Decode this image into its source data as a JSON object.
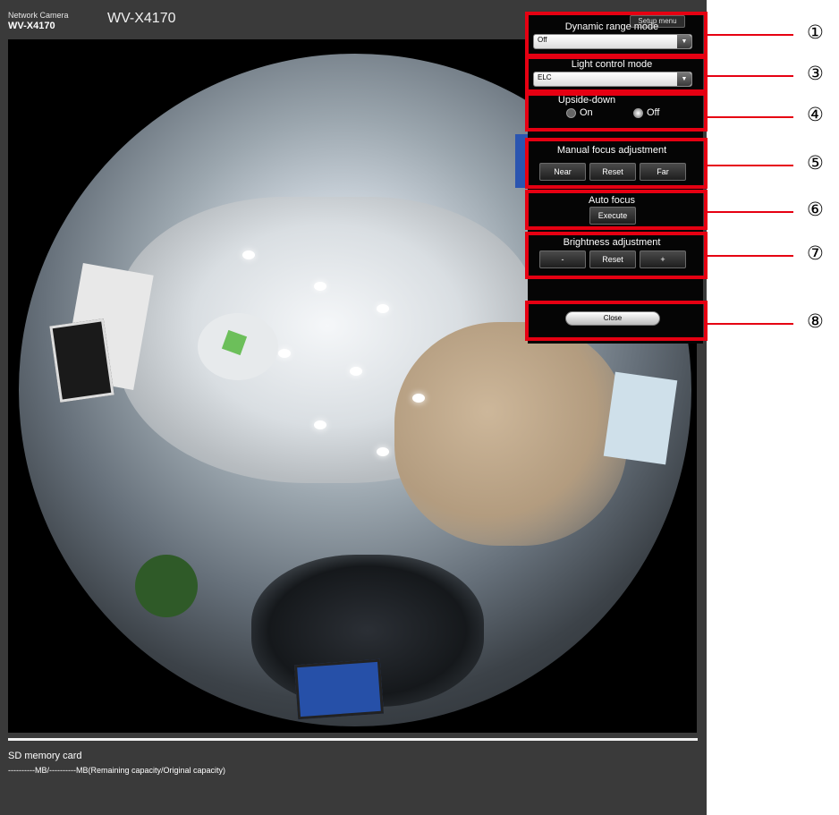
{
  "header": {
    "brand_small": "Network Camera",
    "brand_model": "WV-X4170",
    "title": "WV-X4170"
  },
  "panel": {
    "setup_menu": "Setup menu",
    "dynamic_range_label": "Dynamic range mode",
    "dynamic_range_value": "Off",
    "light_control_label": "Light control mode",
    "light_control_value": "ELC",
    "upside_down_label": "Upside-down",
    "upside_down_on": "On",
    "upside_down_off": "Off",
    "upside_down_selected": "Off",
    "manual_focus_label": "Manual focus adjustment",
    "near": "Near",
    "focus_reset": "Reset",
    "far": "Far",
    "auto_focus_label": "Auto focus",
    "execute": "Execute",
    "brightness_label": "Brightness adjustment",
    "minus": "-",
    "brightness_reset": "Reset",
    "plus": "+",
    "close": "Close"
  },
  "callouts": [
    "①",
    "③",
    "④",
    "⑤",
    "⑥",
    "⑦",
    "⑧"
  ],
  "sd": {
    "title": "SD memory card",
    "capacity": "----------MB/----------MB(Remaining capacity/Original capacity)"
  },
  "colors": {
    "annotation_red": "#e60012",
    "panel_bg": "#050505",
    "app_bg": "#3a3a3a"
  }
}
